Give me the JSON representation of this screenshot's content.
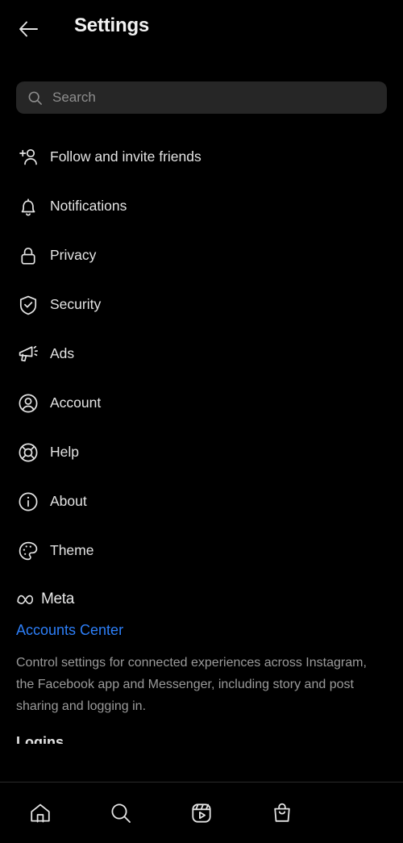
{
  "header": {
    "title": "Settings",
    "back_icon": "arrow-left-icon"
  },
  "search": {
    "placeholder": "Search",
    "icon": "search-icon"
  },
  "menu": {
    "items": [
      {
        "label": "Follow and invite friends",
        "icon": "person-add-icon"
      },
      {
        "label": "Notifications",
        "icon": "bell-icon"
      },
      {
        "label": "Privacy",
        "icon": "lock-icon"
      },
      {
        "label": "Security",
        "icon": "shield-check-icon"
      },
      {
        "label": "Ads",
        "icon": "megaphone-icon"
      },
      {
        "label": "Account",
        "icon": "person-circle-icon"
      },
      {
        "label": "Help",
        "icon": "lifebuoy-icon"
      },
      {
        "label": "About",
        "icon": "info-circle-icon"
      },
      {
        "label": "Theme",
        "icon": "palette-icon"
      }
    ]
  },
  "meta_section": {
    "logo_icon": "meta-infinity-icon",
    "brand": "Meta",
    "link_label": "Accounts Center",
    "link_color": "#2d7ff9",
    "description": "Control settings for connected experiences across Instagram, the Facebook app and Messenger, including story and post sharing and logging in.",
    "next_section_clipped": "Logins"
  },
  "bottom_nav": {
    "items": [
      {
        "name": "home",
        "icon": "home-icon"
      },
      {
        "name": "search",
        "icon": "search-icon"
      },
      {
        "name": "reels",
        "icon": "reels-icon"
      },
      {
        "name": "shop",
        "icon": "shopping-bag-icon"
      }
    ]
  },
  "colors": {
    "background": "#000000",
    "search_field": "#262626",
    "primary_text": "#e4e4e4",
    "secondary_text": "#9a9a9a",
    "link": "#2d7ff9"
  }
}
